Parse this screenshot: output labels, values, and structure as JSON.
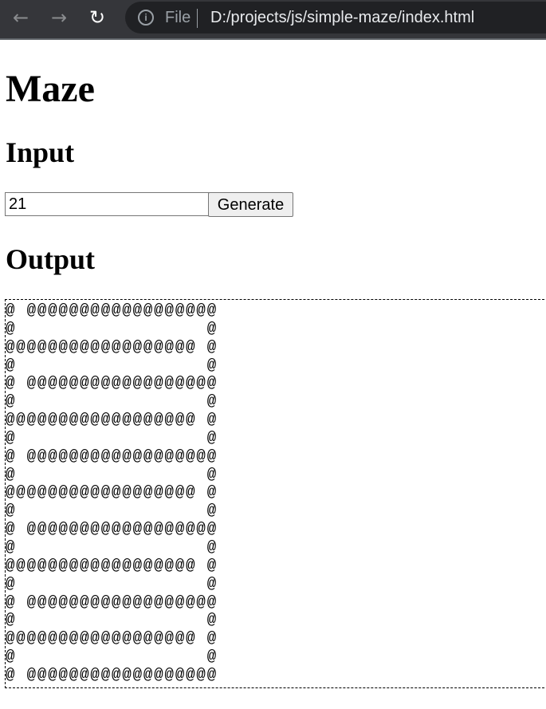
{
  "browser": {
    "back_icon": "arrow-left",
    "forward_icon": "arrow-right",
    "reload_icon": "reload",
    "scheme": "File",
    "url": "D:/projects/js/simple-maze/index.html"
  },
  "page": {
    "title": "Maze",
    "input_heading": "Input",
    "size_value": "21",
    "generate_label": "Generate",
    "output_heading": "Output",
    "maze": "@ @@@@@@@@@@@@@@@@@@\n@                  @\n@@@@@@@@@@@@@@@@@@ @\n@                  @\n@ @@@@@@@@@@@@@@@@@@\n@                  @\n@@@@@@@@@@@@@@@@@@ @\n@                  @\n@ @@@@@@@@@@@@@@@@@@\n@                  @\n@@@@@@@@@@@@@@@@@@ @\n@                  @\n@ @@@@@@@@@@@@@@@@@@\n@                  @\n@@@@@@@@@@@@@@@@@@ @\n@                  @\n@ @@@@@@@@@@@@@@@@@@\n@                  @\n@@@@@@@@@@@@@@@@@@ @\n@                  @\n@ @@@@@@@@@@@@@@@@@@"
  }
}
